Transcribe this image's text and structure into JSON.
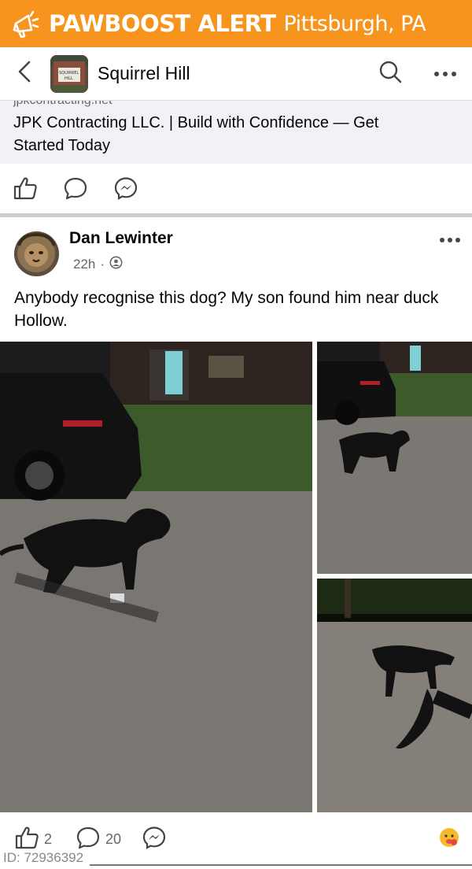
{
  "banner": {
    "title": "PAWBOOST ALERT",
    "location": "Pittsburgh, PA",
    "icon": "megaphone-icon",
    "color": "#f7941d"
  },
  "group": {
    "name": "Squirrel Hill",
    "thumb_text_1": "SQUIRREL",
    "thumb_text_2": "HILL"
  },
  "ad": {
    "domain": "jpkcontracting.net",
    "title": "JPK Contracting LLC. | Build with Confidence — Get Started Today"
  },
  "post": {
    "author": "Dan Lewinter",
    "time": "22h",
    "text": "Anybody recognise this dog? My son found him near duck Hollow.",
    "like_count": "2",
    "comment_count": "20"
  },
  "footer": {
    "id_label": "ID: 72936392"
  }
}
